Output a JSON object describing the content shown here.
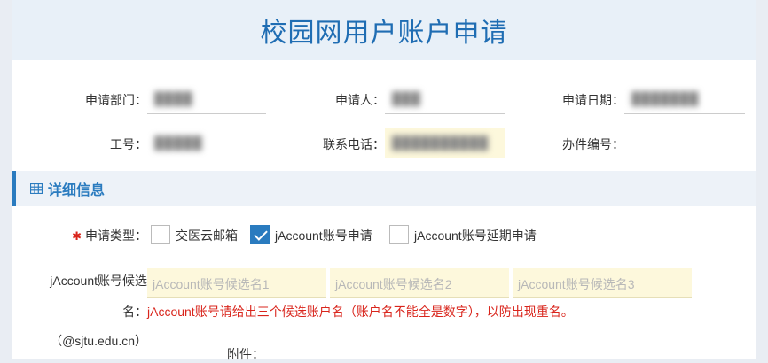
{
  "header": {
    "title": "校园网用户账户申请"
  },
  "form": {
    "department_label": "申请部门：",
    "department_value": "████",
    "applicant_label": "申请人：",
    "applicant_value": "███",
    "date_label": "申请日期：",
    "date_value": "███████",
    "job_no_label": "工号：",
    "job_no_value": "█████",
    "phone_label": "联系电话：",
    "phone_value": "██████████",
    "case_no_label": "办件编号：",
    "case_no_value": ""
  },
  "section": {
    "title": "详细信息",
    "icon": "table-icon"
  },
  "apply_type": {
    "label": "申请类型：",
    "options": [
      {
        "label": "交医云邮箱",
        "checked": false
      },
      {
        "label": "jAccount账号申请",
        "checked": true
      },
      {
        "label": "jAccount账号延期申请",
        "checked": false
      }
    ]
  },
  "jaccount": {
    "label_line1": "jAccount账号候选",
    "label_line2": "名：",
    "label_line3": "（@sjtu.edu.cn）",
    "placeholders": [
      "jAccount账号候选名1",
      "jAccount账号候选名2",
      "jAccount账号候选名3"
    ],
    "hint": "jAccount账号请给出三个候选账户名（账户名不能全是数字），以防出现重名。"
  },
  "attachment": {
    "label": "附件："
  },
  "colors": {
    "accent": "#2a7bbf",
    "title": "#1f6db3",
    "warning": "#d9251c",
    "highlight": "#fdf8dc"
  }
}
